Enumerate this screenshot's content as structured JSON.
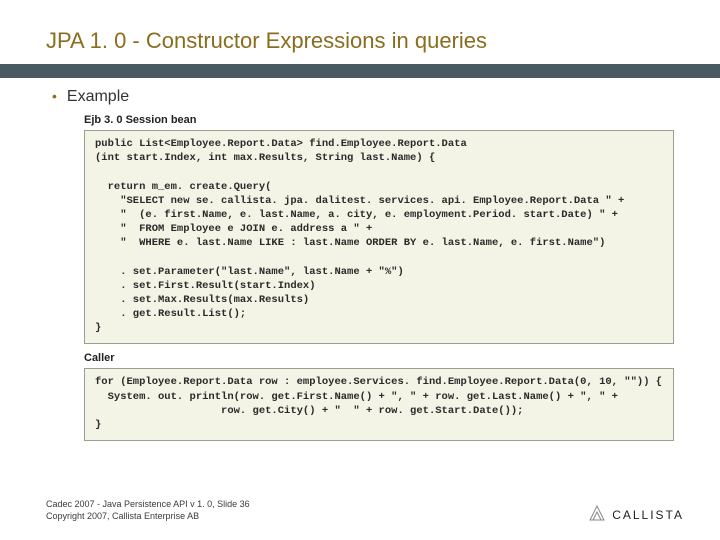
{
  "title": "JPA 1. 0 - Constructor Expressions in queries",
  "bullet": "Example",
  "sub1": "Ejb 3. 0 Session bean",
  "code1": "public List<Employee.Report.Data> find.Employee.Report.Data\n(int start.Index, int max.Results, String last.Name) {\n\n  return m_em. create.Query(\n    \"SELECT new se. callista. jpa. dalitest. services. api. Employee.Report.Data \" +\n    \"  (e. first.Name, e. last.Name, a. city, e. employment.Period. start.Date) \" +\n    \"  FROM Employee e JOIN e. address a \" +\n    \"  WHERE e. last.Name LIKE : last.Name ORDER BY e. last.Name, e. first.Name\")\n\n    . set.Parameter(\"last.Name\", last.Name + \"%\")\n    . set.First.Result(start.Index)\n    . set.Max.Results(max.Results)\n    . get.Result.List();\n}",
  "sub2": "Caller",
  "code2": "for (Employee.Report.Data row : employee.Services. find.Employee.Report.Data(0, 10, \"\")) {\n  System. out. println(row. get.First.Name() + \", \" + row. get.Last.Name() + \", \" +\n                    row. get.City() + \"  \" + row. get.Start.Date());\n}",
  "footer1": "Cadec 2007 - Java Persistence API v 1. 0, Slide 36",
  "footer2": "Copyright 2007, Callista Enterprise AB",
  "logo": "CALLISTA"
}
